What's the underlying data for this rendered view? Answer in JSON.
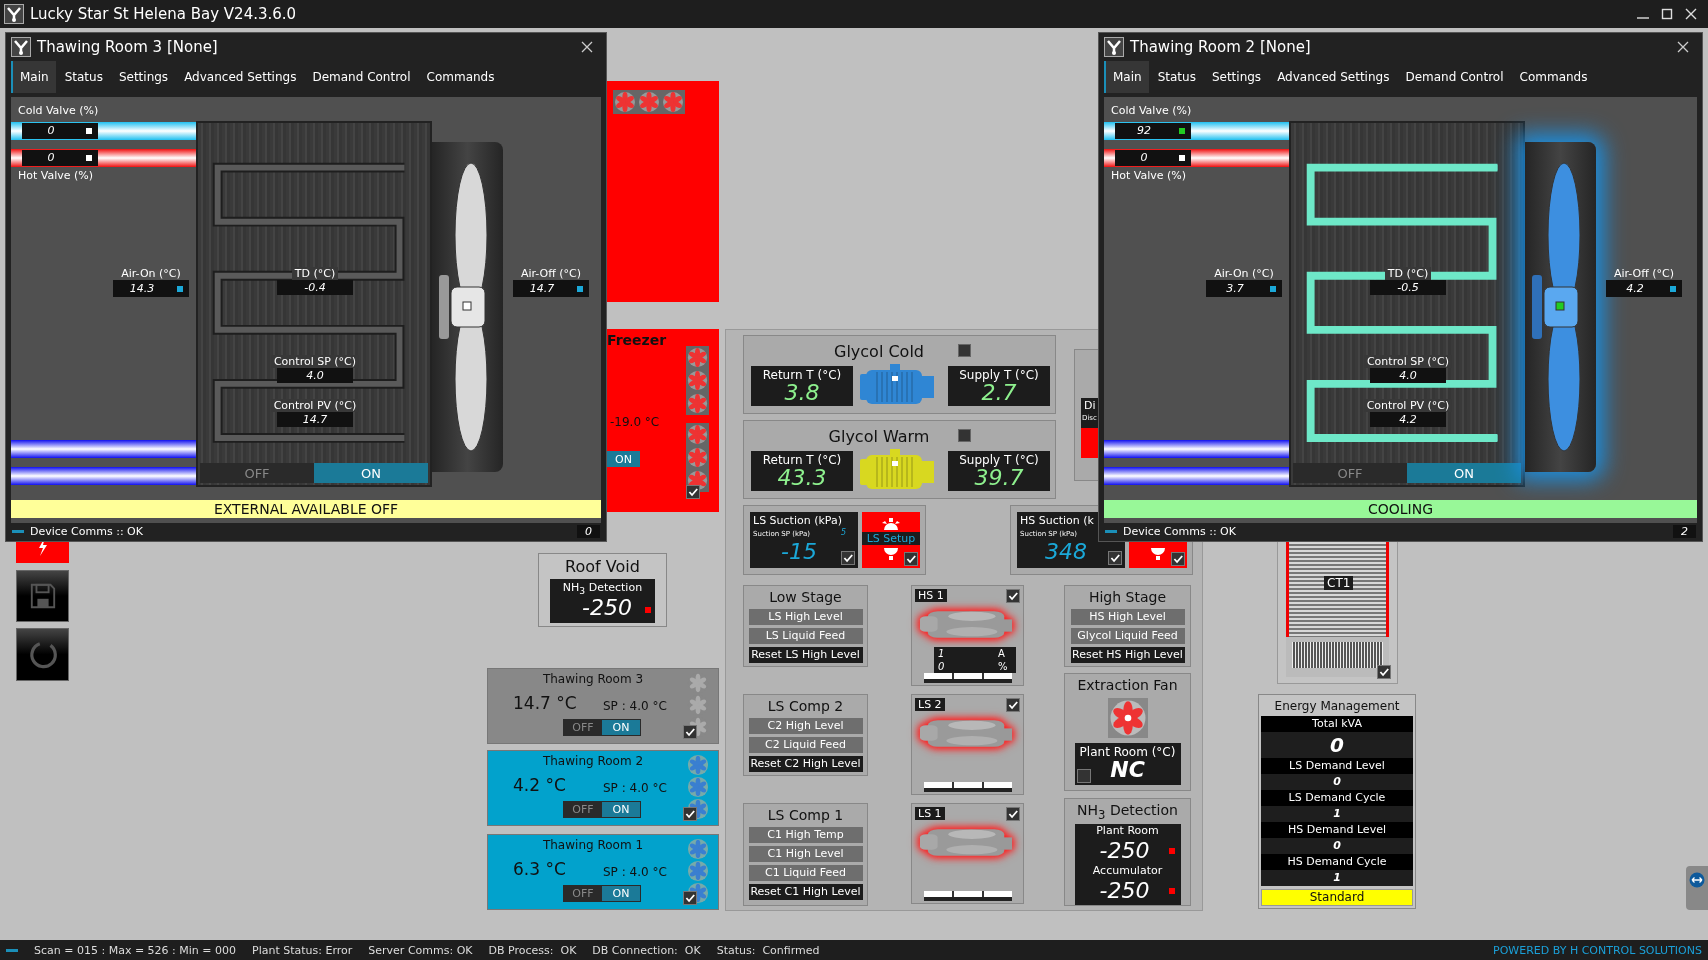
{
  "app_title": "Lucky Star St Helena Bay V24.3.6.0",
  "windows": [
    {
      "title": "Thawing Room 3 [None]",
      "tabs": [
        {
          "label": "Main",
          "selected": true
        },
        {
          "label": "Status",
          "selected": false
        },
        {
          "label": "Settings",
          "selected": false
        },
        {
          "label": "Advanced Settings",
          "selected": false
        },
        {
          "label": "Demand Control",
          "selected": false
        },
        {
          "label": "Commands",
          "selected": false
        }
      ],
      "cold_valve": {
        "label": "Cold Valve (%)",
        "value": "0",
        "active": false
      },
      "hot_valve": {
        "label": "Hot Valve (%)",
        "value": "0",
        "active": false
      },
      "air_on": {
        "label": "Air-On (°C)",
        "value": "14.3"
      },
      "td": {
        "label": "TD (°C)",
        "value": "-0.4"
      },
      "control_sp": {
        "label": "Control SP (°C)",
        "value": "4.0"
      },
      "control_pv": {
        "label": "Control PV (°C)",
        "value": "14.7"
      },
      "air_off": {
        "label": "Air-Off (°C)",
        "value": "14.7"
      },
      "cooling": false,
      "off_on": [
        {
          "label": "OFF",
          "selected": false
        },
        {
          "label": "ON",
          "selected": true
        }
      ],
      "status": {
        "text": "EXTERNAL AVAILABLE OFF",
        "color": "#ffff99"
      },
      "comms": "Device Comms :: OK",
      "footer_value": "0"
    },
    {
      "title": "Thawing Room 2 [None]",
      "tabs": [
        {
          "label": "Main",
          "selected": true
        },
        {
          "label": "Status",
          "selected": false
        },
        {
          "label": "Settings",
          "selected": false
        },
        {
          "label": "Advanced Settings",
          "selected": false
        },
        {
          "label": "Demand Control",
          "selected": false
        },
        {
          "label": "Commands",
          "selected": false
        }
      ],
      "cold_valve": {
        "label": "Cold Valve (%)",
        "value": "92",
        "active": true
      },
      "hot_valve": {
        "label": "Hot Valve (%)",
        "value": "0",
        "active": false
      },
      "air_on": {
        "label": "Air-On (°C)",
        "value": "3.7"
      },
      "td": {
        "label": "TD (°C)",
        "value": "-0.5"
      },
      "control_sp": {
        "label": "Control SP (°C)",
        "value": "4.0"
      },
      "control_pv": {
        "label": "Control PV (°C)",
        "value": "4.2"
      },
      "air_off": {
        "label": "Air-Off (°C)",
        "value": "4.2"
      },
      "cooling": true,
      "off_on": [
        {
          "label": "OFF",
          "selected": false
        },
        {
          "label": "ON",
          "selected": true
        }
      ],
      "status": {
        "text": "COOLING",
        "color": "#98f898"
      },
      "comms": "Device Comms :: OK",
      "footer_value": "2"
    }
  ],
  "red_unit": {
    "alarm": true
  },
  "freezer": {
    "name": "Freezer",
    "temperature": "-19.0 °C",
    "button": "ON",
    "alarm": true,
    "checked": true
  },
  "roof_void": {
    "title": "Roof Void",
    "label": "NH$_{3}$ Detection",
    "value": "-250",
    "alarm": true
  },
  "room_tiles": [
    {
      "name": "Thawing Room 3",
      "temperature": "14.7 °C",
      "setpoint": "SP : 4.0 °C",
      "cooling": false,
      "off_on": [
        {
          "label": "OFF",
          "selected": false
        },
        {
          "label": "ON",
          "selected": true
        }
      ],
      "checked": true
    },
    {
      "name": "Thawing Room 2",
      "temperature": "4.2 °C",
      "setpoint": "SP : 4.0 °C",
      "cooling": true,
      "off_on": [
        {
          "label": "OFF",
          "selected": false
        },
        {
          "label": "ON",
          "selected": true
        }
      ],
      "checked": true
    },
    {
      "name": "Thawing Room 1",
      "temperature": "6.3 °C",
      "setpoint": "SP : 4.0 °C",
      "cooling": true,
      "off_on": [
        {
          "label": "OFF",
          "selected": false
        },
        {
          "label": "ON",
          "selected": true
        }
      ],
      "checked": true
    }
  ],
  "glycol": [
    {
      "name": "Glycol Cold",
      "return_label": "Return T (°C)",
      "return_value": "3.8",
      "supply_label": "Supply T (°C)",
      "supply_value": "2.7",
      "color": "#2f86d4"
    },
    {
      "name": "Glycol Warm",
      "return_label": "Return T (°C)",
      "return_value": "43.3",
      "supply_label": "Supply T (°C)",
      "supply_value": "39.7",
      "color": "#d8d820"
    }
  ],
  "discharge_panel": {
    "title": "Di",
    "label": "Disc",
    "alarm": true
  },
  "suction": [
    {
      "title": "LS Suction (kPa)",
      "sp_label": "Suction SP (kPa)",
      "sp_value": "5",
      "value": "-15",
      "checked": true,
      "setup_label": "LS Setup",
      "setup_checked": true
    },
    {
      "title": "HS Suction (k",
      "sp_label": "Suction SP (kPa)",
      "value": "348",
      "checked": true,
      "setup_checked": true
    }
  ],
  "stages": [
    {
      "title": "Low Stage",
      "items": [
        {
          "label": "LS High Level",
          "kind": "alarm"
        },
        {
          "label": "LS Liquid Feed",
          "kind": "alarm"
        },
        {
          "label": "Reset LS High Level",
          "kind": "reset"
        }
      ]
    },
    {
      "title": "LS Comp 2",
      "items": [
        {
          "label": "C2 High Level",
          "kind": "alarm"
        },
        {
          "label": "C2 Liquid Feed",
          "kind": "alarm"
        },
        {
          "label": "Reset C2 High Level",
          "kind": "reset"
        }
      ]
    },
    {
      "title": "LS Comp 1",
      "items": [
        {
          "label": "C1 High Temp",
          "kind": "alarm"
        },
        {
          "label": "C1 High Level",
          "kind": "alarm"
        },
        {
          "label": "C1 Liquid Feed",
          "kind": "alarm"
        },
        {
          "label": "Reset C1 High Level",
          "kind": "reset"
        }
      ]
    }
  ],
  "compressors": [
    {
      "name": "HS 1",
      "checked": true,
      "alarm": true,
      "amps": "1",
      "amps_unit": "A",
      "load": "0",
      "load_unit": "%"
    },
    {
      "name": "LS 2",
      "checked": true,
      "alarm": true
    },
    {
      "name": "LS 1",
      "checked": true,
      "alarm": true
    }
  ],
  "high_stage": {
    "title": "High Stage",
    "items": [
      {
        "label": "HS High Level",
        "kind": "alarm"
      },
      {
        "label": "Glycol Liquid Feed",
        "kind": "alarm"
      },
      {
        "label": "Reset HS High Level",
        "kind": "reset"
      }
    ]
  },
  "extraction_fan": {
    "title": "Extraction Fan",
    "label": "Plant Room (°C)",
    "value": "NC",
    "checked": false
  },
  "nh3": {
    "title": "NH$_{3}$ Detection",
    "readings": [
      {
        "label": "Plant Room",
        "value": "-250",
        "alarm": true
      },
      {
        "label": "Accumulator",
        "value": "-250",
        "alarm": true
      }
    ]
  },
  "cooling_tower": {
    "name": "CT1",
    "checked": true,
    "alarm": true
  },
  "energy": {
    "title": "Energy Management",
    "rows": [
      {
        "label": "Total kVA",
        "value": "0"
      },
      {
        "label": "LS Demand Level",
        "value": "0"
      },
      {
        "label": "LS Demand Cycle",
        "value": "1"
      },
      {
        "label": "HS Demand Level",
        "value": "0"
      },
      {
        "label": "HS Demand Cycle",
        "value": "1"
      }
    ],
    "mode": "Standard"
  },
  "status_bar": {
    "items": [
      "Scan = 015 : Max = 526 : Min = 000",
      "Plant Status: Error",
      "Server Comms: OK",
      "DB Process:  OK",
      "DB Connection:  OK",
      "Status:  Confirmed"
    ],
    "credit": "POWERED BY H CONTROL SOLUTIONS"
  }
}
